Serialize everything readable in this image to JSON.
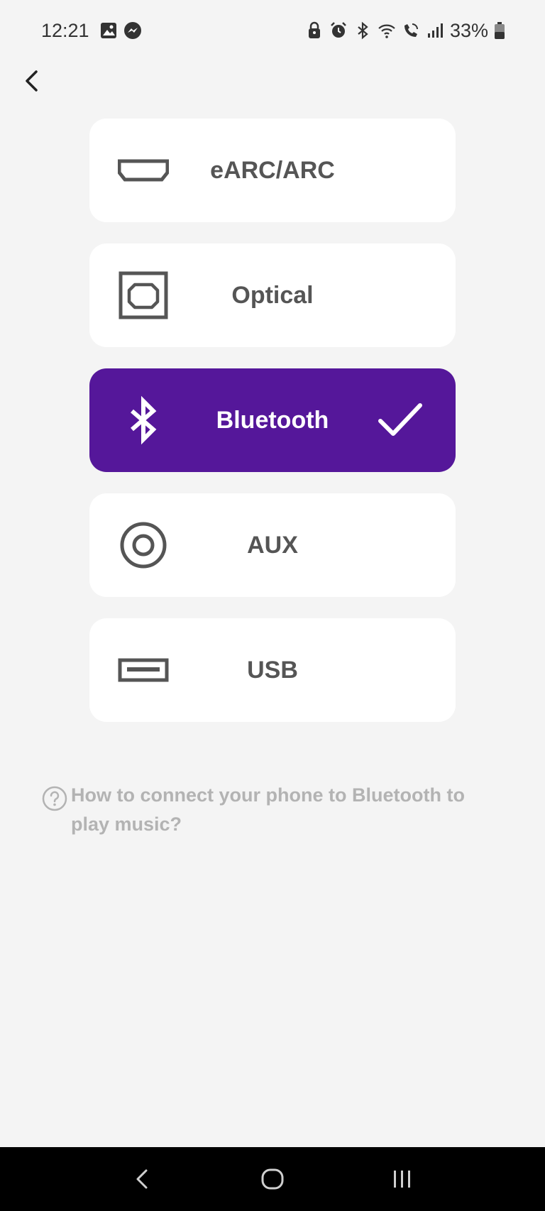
{
  "status_bar": {
    "time": "12:21",
    "battery_percent": "33%",
    "left_icons": [
      "gallery-icon",
      "messenger-icon"
    ],
    "right_icons": [
      "lock-icon",
      "alarm-icon",
      "bluetooth-icon",
      "wifi-icon",
      "wifi-calling-icon",
      "signal-icon",
      "battery-icon"
    ]
  },
  "header": {
    "back_icon": "chevron-left-icon"
  },
  "options": [
    {
      "label": "eARC/ARC",
      "icon": "hdmi-port-icon",
      "selected": false
    },
    {
      "label": "Optical",
      "icon": "optical-port-icon",
      "selected": false
    },
    {
      "label": "Bluetooth",
      "icon": "bluetooth-icon",
      "selected": true
    },
    {
      "label": "AUX",
      "icon": "aux-port-icon",
      "selected": false
    },
    {
      "label": "USB",
      "icon": "usb-port-icon",
      "selected": false
    }
  ],
  "help": {
    "text": "How to connect your phone to Bluetooth to play music?",
    "icon": "question-circle-icon"
  },
  "colors": {
    "selected_background": "#55179a",
    "card_background": "#ffffff",
    "page_background": "#f4f4f4",
    "label_color": "#555555",
    "help_text_color": "#b3b3b3",
    "nav_bar_background": "#000000"
  },
  "nav_bar": {
    "buttons": [
      "back-nav-icon",
      "home-nav-icon",
      "recents-nav-icon"
    ]
  }
}
